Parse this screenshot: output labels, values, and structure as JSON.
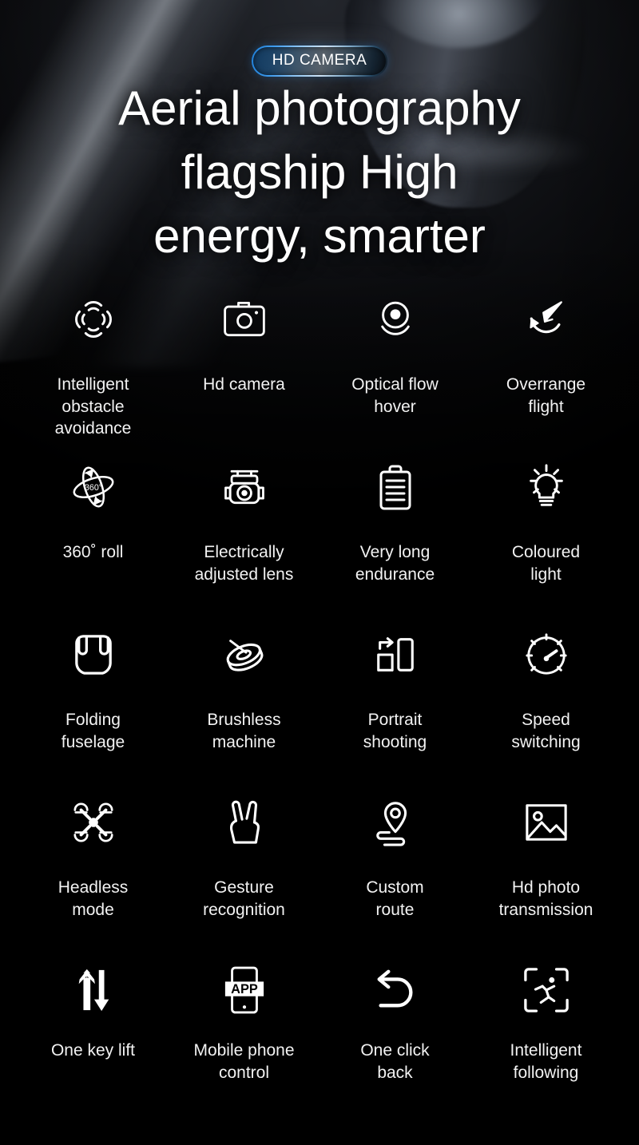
{
  "badge": {
    "label": "HD CAMERA",
    "border_color": "#2b86dc"
  },
  "headline": {
    "line1": "Aerial photography",
    "line2": "flagship High",
    "line3": "energy, smarter",
    "color": "#ffffff"
  },
  "background": {
    "color": "#000000"
  },
  "features": [
    {
      "icon": "obstacle-avoidance-icon",
      "label": "Intelligent\nobstacle\navoidance"
    },
    {
      "icon": "camera-icon",
      "label": "Hd camera"
    },
    {
      "icon": "optical-flow-icon",
      "label": "Optical flow\nhover"
    },
    {
      "icon": "overrange-flight-icon",
      "label": "Overrange\nflight"
    },
    {
      "icon": "360-roll-icon",
      "label": "360˚  roll"
    },
    {
      "icon": "gimbal-camera-icon",
      "label": "Electrically\nadjusted lens"
    },
    {
      "icon": "battery-icon",
      "label": "Very long\nendurance"
    },
    {
      "icon": "light-bulb-icon",
      "label": "Coloured\nlight"
    },
    {
      "icon": "folding-fuselage-icon",
      "label": "Folding\nfuselage"
    },
    {
      "icon": "brushless-motor-icon",
      "label": "Brushless\nmachine"
    },
    {
      "icon": "portrait-shooting-icon",
      "label": "Portrait\nshooting"
    },
    {
      "icon": "speedometer-icon",
      "label": "Speed\nswitching"
    },
    {
      "icon": "drone-icon",
      "label": "Headless\nmode"
    },
    {
      "icon": "hand-gesture-icon",
      "label": "Gesture\nrecognition"
    },
    {
      "icon": "map-route-icon",
      "label": "Custom\nroute"
    },
    {
      "icon": "photo-image-icon",
      "label": "Hd photo\ntransmission"
    },
    {
      "icon": "up-down-arrows-icon",
      "label": "One key lift"
    },
    {
      "icon": "phone-app-icon",
      "label": "Mobile phone\ncontrol",
      "glyph_text": "APP"
    },
    {
      "icon": "return-arrow-icon",
      "label": "One click\nback"
    },
    {
      "icon": "follow-tracking-icon",
      "label": "Intelligent\nfollowing"
    }
  ]
}
